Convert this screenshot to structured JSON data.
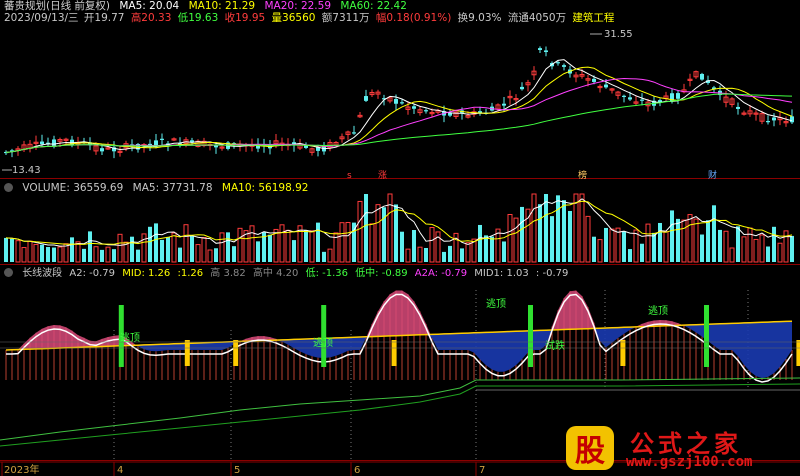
{
  "header1": {
    "title": "蕃贵规划(日线 前复权)",
    "ma5": "MA5: 20.04",
    "ma10": "MA10: 21.29",
    "ma20": "MA20: 22.59",
    "ma60": "MA60: 22.42"
  },
  "header2": {
    "date": "2023/09/13/三",
    "open": "开19.77",
    "high": "高20.33",
    "low": "低19.63",
    "close": "收19.95",
    "volume": "量36560",
    "amount": "额7311万",
    "change": "幅0.18(0.91%)",
    "turnover": "换9.03%",
    "float": "流通4050万",
    "sector": "建筑工程"
  },
  "price_panel": {
    "high_label": "31.55",
    "low_label": "13.43",
    "markers": [
      "s",
      "涨",
      "榜",
      "财"
    ]
  },
  "volume_panel": {
    "volume": "VOLUME: 36559.69",
    "ma5": "MA5: 37731.78",
    "ma10": "MA10: 56198.92"
  },
  "indicator_panel": {
    "name": "长线波段",
    "a2": "A2: -0.79",
    "mid": "MID: 1.26",
    "mid2": ":1.26",
    "high": "高 3.82",
    "highmid": "高中 4.20",
    "low": "低: -1.36",
    "lowmid": "低中: -0.89",
    "a2a": "A2A: -0.79",
    "mid1": "MID1: 1.03",
    "last": ": -0.79",
    "labels": [
      "逃顶",
      "逃顶",
      "逃顶",
      "逃顶",
      "试跌"
    ]
  },
  "time_axis": {
    "labels": [
      "2023年",
      "4",
      "5",
      "6",
      "7"
    ]
  },
  "watermark": {
    "badge": "股",
    "title": "公式之家",
    "url": "www.gszj100.com"
  },
  "colors": {
    "up": "#ff3c3c",
    "down": "#5ff0f0",
    "ma5": "#ffffff",
    "ma10": "#ffff00",
    "ma20": "#ff40ff",
    "ma60": "#40ff40"
  }
}
